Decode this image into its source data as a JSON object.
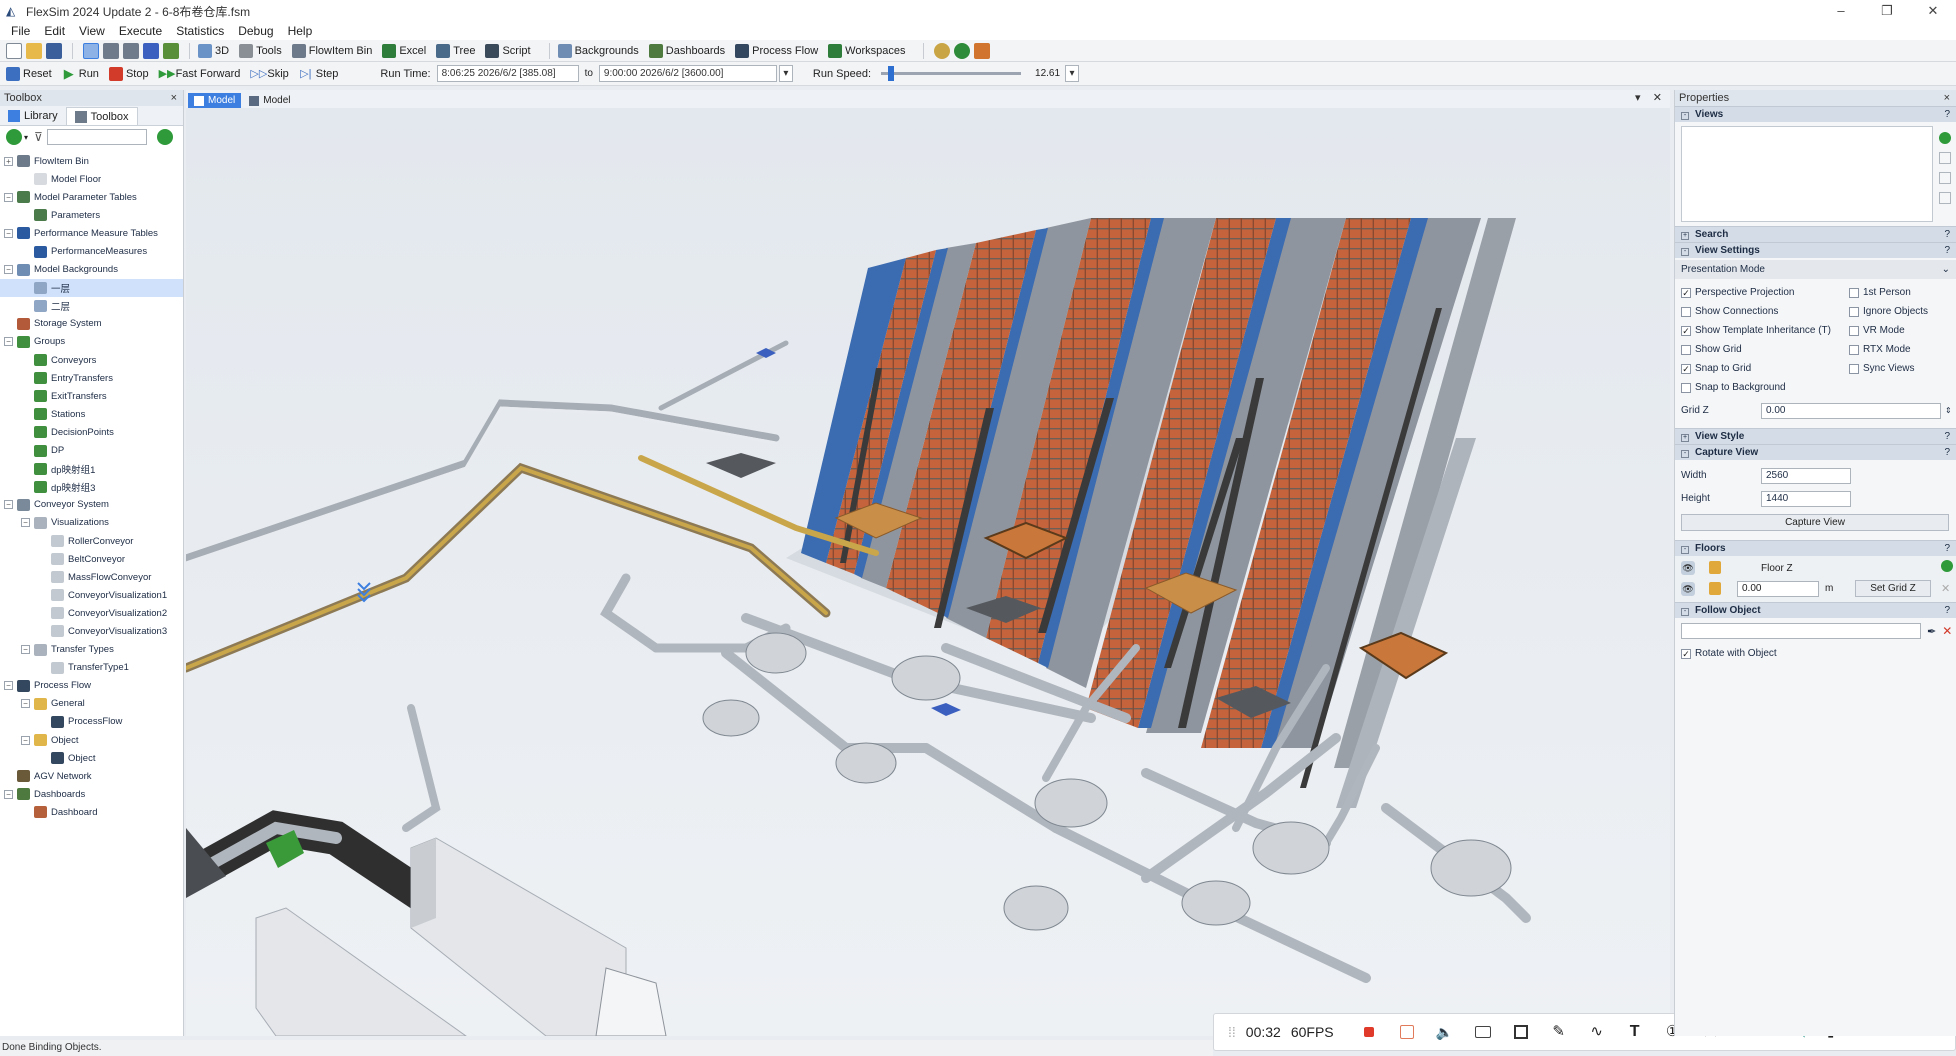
{
  "window": {
    "title": "FlexSim 2024 Update 2 - 6-8布卷仓库.fsm",
    "minimize": "–",
    "maximize": "❐",
    "close": "✕"
  },
  "menu": [
    "File",
    "Edit",
    "View",
    "Execute",
    "Statistics",
    "Debug",
    "Help"
  ],
  "toolbar1": {
    "buttons": [
      "3D",
      "Tools",
      "FlowItem Bin",
      "Excel",
      "Tree",
      "Script",
      "Backgrounds",
      "Dashboards",
      "Process Flow",
      "Workspaces"
    ]
  },
  "toolbar2": {
    "reset": "Reset",
    "run": "Run",
    "stop": "Stop",
    "fast_forward": "Fast Forward",
    "skip": "Skip",
    "step": "Step",
    "run_time_label": "Run Time:",
    "run_time_value": "8:06:25  2026/6/2  [385.08]",
    "to_label": "to",
    "stop_time_value": "9:00:00  2026/6/2  [3600.00]",
    "run_speed_label": "Run Speed:",
    "run_speed_value": "12.61",
    "run_speed_fraction": 0.05
  },
  "left_panel": {
    "header": "Toolbox",
    "close": "×",
    "tabs": [
      "Library",
      "Toolbox"
    ],
    "tree": [
      {
        "label": "FlowItem Bin",
        "indent": 0,
        "exp": "+",
        "icon": "#6c7a8a"
      },
      {
        "label": "Model Floor",
        "indent": 1,
        "exp": "",
        "icon": "#d7dadf"
      },
      {
        "label": "Model Parameter Tables",
        "indent": 0,
        "exp": "-",
        "icon": "#4b7a4b"
      },
      {
        "label": "Parameters",
        "indent": 1,
        "exp": "",
        "icon": "#4b7a4b"
      },
      {
        "label": "Performance Measure Tables",
        "indent": 0,
        "exp": "-",
        "icon": "#2c5aa0"
      },
      {
        "label": "PerformanceMeasures",
        "indent": 1,
        "exp": "",
        "icon": "#2c5aa0"
      },
      {
        "label": "Model Backgrounds",
        "indent": 0,
        "exp": "-",
        "icon": "#6f8db3"
      },
      {
        "label": "一层",
        "indent": 1,
        "exp": "",
        "icon": "#8fa6c4",
        "selected": true
      },
      {
        "label": "二层",
        "indent": 1,
        "exp": "",
        "icon": "#8fa6c4"
      },
      {
        "label": "Storage System",
        "indent": 0,
        "exp": "",
        "icon": "#b25a3a"
      },
      {
        "label": "Groups",
        "indent": 0,
        "exp": "-",
        "icon": "#3f8f3f"
      },
      {
        "label": "Conveyors",
        "indent": 1,
        "exp": "",
        "icon": "#3f8f3f"
      },
      {
        "label": "EntryTransfers",
        "indent": 1,
        "exp": "",
        "icon": "#3f8f3f"
      },
      {
        "label": "ExitTransfers",
        "indent": 1,
        "exp": "",
        "icon": "#3f8f3f"
      },
      {
        "label": "Stations",
        "indent": 1,
        "exp": "",
        "icon": "#3f8f3f"
      },
      {
        "label": "DecisionPoints",
        "indent": 1,
        "exp": "",
        "icon": "#3f8f3f"
      },
      {
        "label": "DP",
        "indent": 1,
        "exp": "",
        "icon": "#3f8f3f"
      },
      {
        "label": "dp映射组1",
        "indent": 1,
        "exp": "",
        "icon": "#3f8f3f"
      },
      {
        "label": "dp映射组3",
        "indent": 1,
        "exp": "",
        "icon": "#3f8f3f"
      },
      {
        "label": "Conveyor System",
        "indent": 0,
        "exp": "-",
        "icon": "#7a8a9a"
      },
      {
        "label": "Visualizations",
        "indent": 1,
        "exp": "-",
        "icon": "#aab3bd"
      },
      {
        "label": "RollerConveyor",
        "indent": 2,
        "exp": "",
        "icon": "#c3c9d0"
      },
      {
        "label": "BeltConveyor",
        "indent": 2,
        "exp": "",
        "icon": "#c3c9d0"
      },
      {
        "label": "MassFlowConveyor",
        "indent": 2,
        "exp": "",
        "icon": "#c3c9d0"
      },
      {
        "label": "ConveyorVisualization1",
        "indent": 2,
        "exp": "",
        "icon": "#c3c9d0"
      },
      {
        "label": "ConveyorVisualization2",
        "indent": 2,
        "exp": "",
        "icon": "#c3c9d0"
      },
      {
        "label": "ConveyorVisualization3",
        "indent": 2,
        "exp": "",
        "icon": "#c3c9d0"
      },
      {
        "label": "Transfer Types",
        "indent": 1,
        "exp": "-",
        "icon": "#aab3bd"
      },
      {
        "label": "TransferType1",
        "indent": 2,
        "exp": "",
        "icon": "#c3c9d0"
      },
      {
        "label": "Process Flow",
        "indent": 0,
        "exp": "-",
        "icon": "#33475e"
      },
      {
        "label": "General",
        "indent": 1,
        "exp": "-",
        "icon": "#e0b64a"
      },
      {
        "label": "ProcessFlow",
        "indent": 2,
        "exp": "",
        "icon": "#33475e"
      },
      {
        "label": "Object",
        "indent": 1,
        "exp": "-",
        "icon": "#e0b64a"
      },
      {
        "label": "Object",
        "indent": 2,
        "exp": "",
        "icon": "#33475e"
      },
      {
        "label": "AGV Network",
        "indent": 0,
        "exp": "",
        "icon": "#6a5a3a"
      },
      {
        "label": "Dashboards",
        "indent": 0,
        "exp": "-",
        "icon": "#4f7a3f"
      },
      {
        "label": "Dashboard",
        "indent": 1,
        "exp": "",
        "icon": "#b5603a"
      }
    ]
  },
  "viewport": {
    "tabs": [
      "Model",
      "Model"
    ],
    "menu_arrow": "▾",
    "close": "✕"
  },
  "recorder": {
    "grip": "⁞⁞",
    "time": "00:32",
    "fps": "60FPS",
    "aux": "A"
  },
  "right_panel": {
    "header": "Properties",
    "close": "×",
    "sections": {
      "views": "Views",
      "search": "Search",
      "view_settings": "View Settings",
      "view_style": "View Style",
      "capture_view": "Capture View",
      "floors": "Floors",
      "follow_object": "Follow Object"
    },
    "help": "?",
    "presentation_mode": "Presentation Mode",
    "checks_left": [
      {
        "label": "Perspective Projection",
        "checked": true
      },
      {
        "label": "Show Connections",
        "checked": false
      },
      {
        "label": "Show Template Inheritance (T)",
        "checked": true
      },
      {
        "label": "Show Grid",
        "checked": false
      },
      {
        "label": "Snap to Grid",
        "checked": true
      },
      {
        "label": "Snap to Background",
        "checked": false
      }
    ],
    "checks_right": [
      {
        "label": "1st Person",
        "checked": false
      },
      {
        "label": "Ignore Objects",
        "checked": false
      },
      {
        "label": "VR Mode",
        "checked": false
      },
      {
        "label": "RTX Mode",
        "checked": false
      },
      {
        "label": "Sync Views",
        "checked": false
      }
    ],
    "grid_z_label": "Grid Z",
    "grid_z_value": "0.00",
    "width_label": "Width",
    "width_value": "2560",
    "height_label": "Height",
    "height_value": "1440",
    "capture_button": "Capture View",
    "floor_name": "Floor Z",
    "floor_value": "0.00",
    "floor_unit": "m",
    "set_grid_button": "Set Grid Z",
    "rotate_with_object": "Rotate with Object"
  },
  "status": {
    "text": "Done Binding Objects."
  },
  "colors": {
    "accent": "#3d7fe0",
    "rack_orange": "#c2663f",
    "rack_blue": "#3b6bb0",
    "floor": "#eef1f4"
  }
}
